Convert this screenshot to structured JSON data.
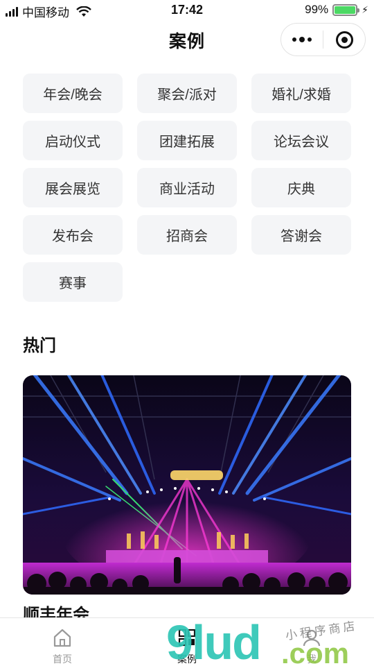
{
  "status_bar": {
    "carrier": "中国移动",
    "time": "17:42",
    "battery": "99%",
    "battery_level": 0.99
  },
  "nav": {
    "title": "案例"
  },
  "categories": [
    "年会/晚会",
    "聚会/派对",
    "婚礼/求婚",
    "启动仪式",
    "团建拓展",
    "论坛会议",
    "展会展览",
    "商业活动",
    "庆典",
    "发布会",
    "招商会",
    "答谢会",
    "赛事"
  ],
  "hot": {
    "title": "热门",
    "items": [
      {
        "name": "顺丰年会"
      }
    ]
  },
  "tabs": [
    {
      "label": "首页",
      "icon": "home-icon"
    },
    {
      "label": "案例",
      "icon": "case-grid-icon"
    },
    {
      "label": "我",
      "icon": "user-icon"
    }
  ],
  "watermark": {
    "brand": "9lud",
    "domain": ".com",
    "tagline": "小程序商店"
  },
  "colors": {
    "accent": "#4cd964",
    "watermark_teal": "#2bc5b4",
    "watermark_green": "#8cc63f",
    "chip_bg": "#f4f5f7"
  }
}
